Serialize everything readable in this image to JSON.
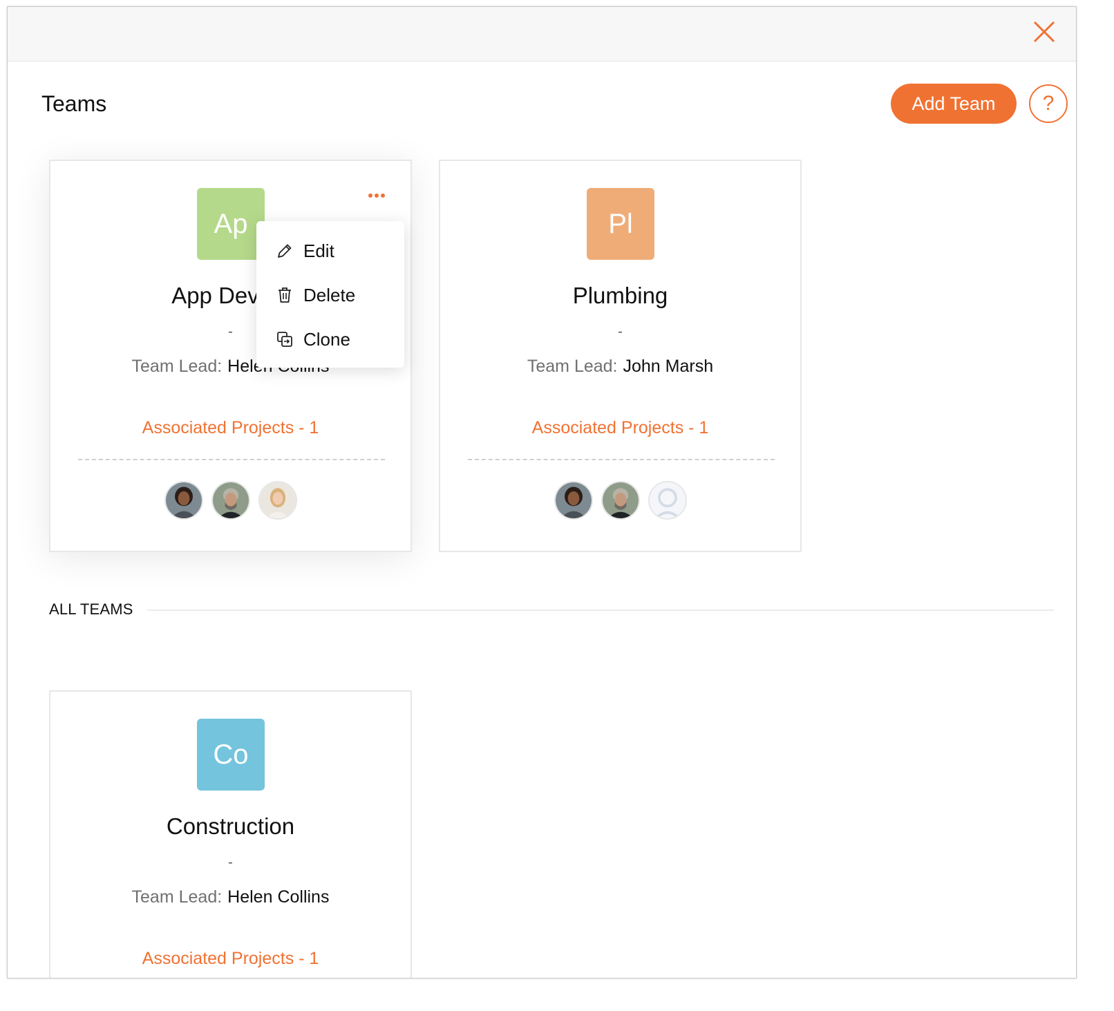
{
  "header": {
    "title": "Teams",
    "add_team_label": "Add Team",
    "help_label": "?"
  },
  "colors": {
    "accent": "#f07233",
    "badge_app": "#b5d98a",
    "badge_plumbing": "#f0ac76",
    "badge_construction": "#74c4dd"
  },
  "menu": {
    "items": [
      {
        "label": "Edit",
        "icon": "pencil-icon"
      },
      {
        "label": "Delete",
        "icon": "trash-icon"
      },
      {
        "label": "Clone",
        "icon": "clone-icon"
      }
    ]
  },
  "pinned_teams": [
    {
      "initials": "Ap",
      "name": "App Develo",
      "description": "-",
      "lead_label": "Team Lead:",
      "lead": "Helen Collins",
      "projects": "Associated Projects - 1",
      "members": [
        "woman-portrait",
        "bearded-man-portrait",
        "blonde-woman-portrait"
      ]
    },
    {
      "initials": "Pl",
      "name": "Plumbing",
      "description": "-",
      "lead_label": "Team Lead:",
      "lead": "John Marsh",
      "projects": "Associated Projects - 1",
      "members": [
        "woman-portrait",
        "bearded-man-portrait",
        "default-avatar"
      ]
    }
  ],
  "section": {
    "label": "ALL TEAMS"
  },
  "all_teams": [
    {
      "initials": "Co",
      "name": "Construction",
      "description": "-",
      "lead_label": "Team Lead:",
      "lead": "Helen Collins",
      "projects": "Associated Projects - 1"
    }
  ]
}
